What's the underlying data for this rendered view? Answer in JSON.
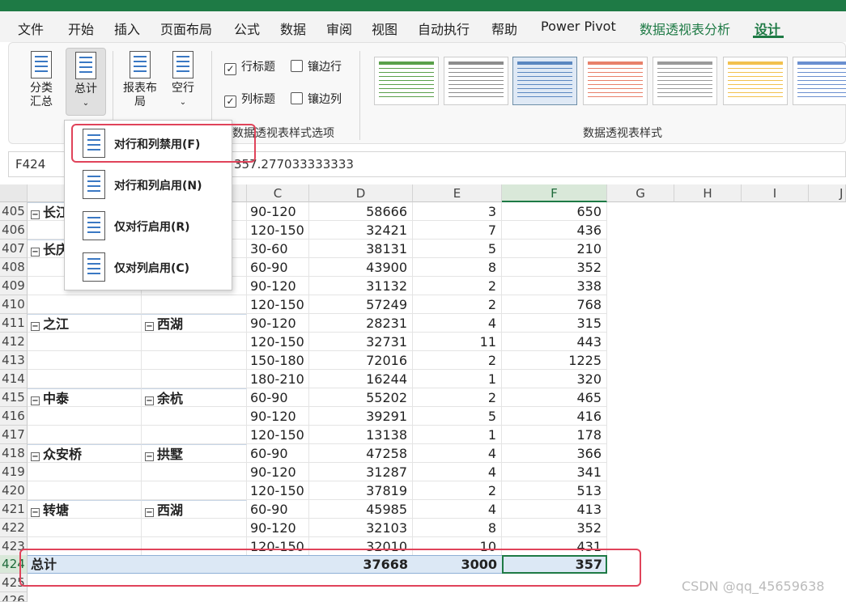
{
  "tabs": [
    "文件",
    "开始",
    "插入",
    "页面布局",
    "公式",
    "数据",
    "审阅",
    "视图",
    "自动执行",
    "帮助",
    "Power Pivot",
    "数据透视表分析",
    "设计"
  ],
  "ribbon": {
    "btn_subtotal": "分类汇总",
    "btn_grandtotal": "总计",
    "btn_layout": "报表布局",
    "btn_blankrows": "空行",
    "cb_row_headers": "行标题",
    "cb_col_headers": "列标题",
    "cb_banded_rows": "镶边行",
    "cb_banded_cols": "镶边列",
    "group_style_options": "数据透视表样式选项",
    "group_styles": "数据透视表样式",
    "style_colors": [
      "#5aa04a",
      "#8c8c8c",
      "#5a87c0",
      "#e8806a",
      "#9a9a9a",
      "#f2c14e",
      "#6a8fd0"
    ]
  },
  "menu": {
    "items": [
      "对行和列禁用(F)",
      "对行和列启用(N)",
      "仅对行启用(R)",
      "仅对列启用(C)"
    ]
  },
  "formula": {
    "name_box": "F424",
    "value": "357.277033333333"
  },
  "columns": [
    "C",
    "D",
    "E",
    "F",
    "G",
    "H",
    "I",
    "J"
  ],
  "rows": [
    {
      "n": "405",
      "a": "长江",
      "b": "",
      "c": "90-120",
      "d": "58666",
      "e": "3",
      "f": "650"
    },
    {
      "n": "406",
      "a": "",
      "b": "",
      "c": "120-150",
      "d": "32421",
      "e": "7",
      "f": "436"
    },
    {
      "n": "407",
      "a": "长庆",
      "b": "",
      "c": "30-60",
      "d": "38131",
      "e": "5",
      "f": "210"
    },
    {
      "n": "408",
      "a": "",
      "b": "",
      "c": "60-90",
      "d": "43900",
      "e": "8",
      "f": "352"
    },
    {
      "n": "409",
      "a": "",
      "b": "",
      "c": "90-120",
      "d": "31132",
      "e": "2",
      "f": "338"
    },
    {
      "n": "410",
      "a": "",
      "b": "",
      "c": "120-150",
      "d": "57249",
      "e": "2",
      "f": "768"
    },
    {
      "n": "411",
      "a": "之江",
      "b": "西湖",
      "c": "90-120",
      "d": "28231",
      "e": "4",
      "f": "315"
    },
    {
      "n": "412",
      "a": "",
      "b": "",
      "c": "120-150",
      "d": "32731",
      "e": "11",
      "f": "443"
    },
    {
      "n": "413",
      "a": "",
      "b": "",
      "c": "150-180",
      "d": "72016",
      "e": "2",
      "f": "1225"
    },
    {
      "n": "414",
      "a": "",
      "b": "",
      "c": "180-210",
      "d": "16244",
      "e": "1",
      "f": "320"
    },
    {
      "n": "415",
      "a": "中泰",
      "b": "余杭",
      "c": "60-90",
      "d": "55202",
      "e": "2",
      "f": "465"
    },
    {
      "n": "416",
      "a": "",
      "b": "",
      "c": "90-120",
      "d": "39291",
      "e": "5",
      "f": "416"
    },
    {
      "n": "417",
      "a": "",
      "b": "",
      "c": "120-150",
      "d": "13138",
      "e": "1",
      "f": "178"
    },
    {
      "n": "418",
      "a": "众安桥",
      "b": "拱墅",
      "c": "60-90",
      "d": "47258",
      "e": "4",
      "f": "366"
    },
    {
      "n": "419",
      "a": "",
      "b": "",
      "c": "90-120",
      "d": "31287",
      "e": "4",
      "f": "341"
    },
    {
      "n": "420",
      "a": "",
      "b": "",
      "c": "120-150",
      "d": "37819",
      "e": "2",
      "f": "513"
    },
    {
      "n": "421",
      "a": "转塘",
      "b": "西湖",
      "c": "60-90",
      "d": "45985",
      "e": "4",
      "f": "413"
    },
    {
      "n": "422",
      "a": "",
      "b": "",
      "c": "90-120",
      "d": "32103",
      "e": "8",
      "f": "352"
    },
    {
      "n": "423",
      "a": "",
      "b": "",
      "c": "120-150",
      "d": "32010",
      "e": "10",
      "f": "431"
    }
  ],
  "total": {
    "n": "424",
    "label": "总计",
    "d": "37668",
    "e": "3000",
    "f": "357"
  },
  "extra_row": "425",
  "partial_row": "426",
  "watermark": "CSDN @qq_45659638"
}
